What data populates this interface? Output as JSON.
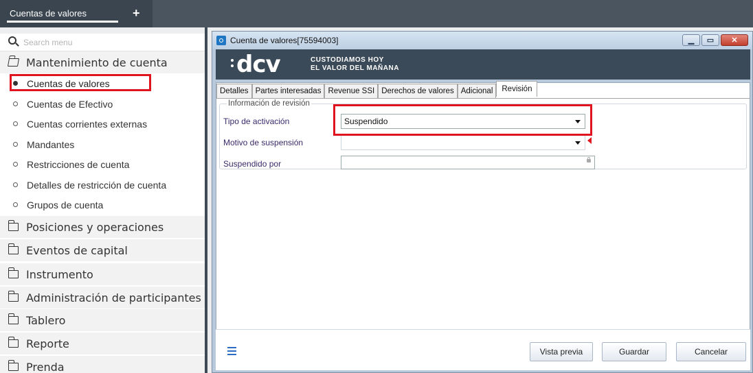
{
  "topbar": {
    "tab_label": "Cuentas de valores",
    "add_symbol": "+"
  },
  "sidebar": {
    "search_placeholder": "Search menu",
    "groups": [
      {
        "label": "Mantenimiento de cuenta"
      },
      {
        "label": "Posiciones y operaciones"
      },
      {
        "label": "Eventos de capital"
      },
      {
        "label": "Instrumento"
      },
      {
        "label": "Administración de participantes"
      },
      {
        "label": "Tablero"
      },
      {
        "label": "Reporte"
      },
      {
        "label": "Prenda"
      }
    ],
    "items": [
      {
        "label": "Cuentas de valores"
      },
      {
        "label": "Cuentas de Efectivo"
      },
      {
        "label": "Cuentas corrientes externas"
      },
      {
        "label": "Mandantes"
      },
      {
        "label": "Restricciones de cuenta"
      },
      {
        "label": "Detalles de restricción de cuenta"
      },
      {
        "label": "Grupos de cuenta"
      }
    ]
  },
  "dialog": {
    "title": "Cuenta de valores[75594003]",
    "banner": {
      "logo": "dcv",
      "tagline_1": "CUSTODIAMOS HOY",
      "tagline_2": "EL VALOR DEL MAÑANA"
    },
    "tabs": [
      "Detalles",
      "Partes interesadas",
      "Revenue SSI",
      "Derechos de valores",
      "Adicional",
      "Revisión"
    ],
    "section_title": "Información de revisión",
    "fields": {
      "tipo_label": "Tipo de activación",
      "tipo_value": "Suspendido",
      "motivo_label": "Motivo de suspensión",
      "motivo_value": "",
      "suspendido_label": "Suspendido por",
      "suspendido_value": ""
    },
    "buttons": {
      "preview": "Vista previa",
      "save": "Guardar",
      "cancel": "Cancelar"
    }
  },
  "colors": {
    "highlight": "#e0141e",
    "topbar": "#4a5560",
    "banner": "#3b4a58"
  }
}
